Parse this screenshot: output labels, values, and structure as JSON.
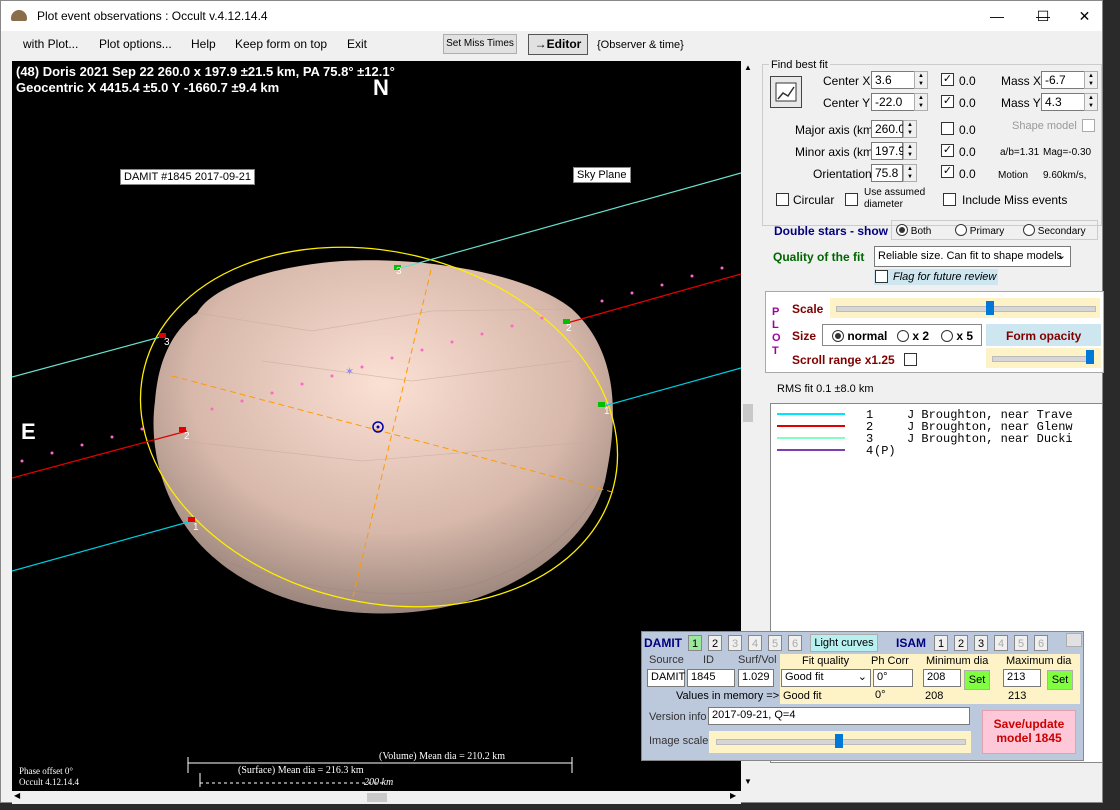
{
  "window": {
    "title": "Plot event observations : Occult v.4.12.14.4",
    "minimize": "—",
    "maximize": "☐",
    "close": "✕"
  },
  "menu": {
    "items": [
      "with Plot...",
      "Plot options...",
      "Help",
      "Keep form on top",
      "Exit"
    ],
    "set_miss_times": "Set Miss Times",
    "editor": "→Editor",
    "observer_time": "{Observer & time}"
  },
  "plot": {
    "header1": "(48) Doris  2021 Sep 22  260.0 x 197.9 ±21.5 km, PA 75.8° ±12.1°",
    "header2": "Geocentric  X  4415.4 ±5.0  Y -1660.7 ±9.4 km",
    "north": "N",
    "east": "E",
    "damit_tag": "DAMIT #1845 2017-09-21",
    "sky_plane": "Sky Plane",
    "phase_offset": "Phase offset 0°",
    "version": "Occult 4.12.14.4",
    "volume_dia": "(Volume) Mean dia = 210.2 km",
    "surface_dia": "(Surface) Mean dia = 216.3 km",
    "scale_bar": "200 km",
    "chord_labels": [
      "1",
      "2",
      "3",
      "1",
      "2",
      "3"
    ]
  },
  "fit": {
    "section_title": "Find best fit",
    "center_x_label": "Center X",
    "center_x": "3.6",
    "center_y_label": "Center Y",
    "center_y": "-22.0",
    "major_label": "Major axis (km)",
    "major": "260.0",
    "minor_label": "Minor axis (km)",
    "minor": "197.9",
    "orient_label": "Orientation",
    "orient": "75.8",
    "zero": "0.0",
    "mass_x_label": "Mass X",
    "mass_x": "-6.7",
    "mass_y_label": "Mass Y",
    "mass_y": "4.3",
    "shape_model_label": "Shape model",
    "ab_ratio": "a/b=1.31",
    "mag": "Mag=-0.30",
    "motion_label": "Motion",
    "motion": "9.60km/s,",
    "circular": "Circular",
    "use_assumed": "Use assumed diameter",
    "include_miss": "Include Miss events",
    "double_stars_label": "Double stars - show",
    "ds_both": "Both",
    "ds_primary": "Primary",
    "ds_secondary": "Secondary",
    "quality_label": "Quality of the fit",
    "quality_value": "Reliable size. Can fit to shape models",
    "flag_review": "Flag for future review"
  },
  "plotbox": {
    "vertical": [
      "P",
      "L",
      "O",
      "T"
    ],
    "scale_label": "Scale",
    "scale_level": 0.6,
    "size_label": "Size",
    "size_normal": "normal",
    "size_x2": "x 2",
    "size_x5": "x 5",
    "form_opacity": "Form opacity",
    "scroll_range": "Scroll range x1.25"
  },
  "rms": "RMS fit 0.1 ±8.0 km",
  "legend": {
    "rows": [
      {
        "color": "#00e5ff",
        "num": "1",
        "text": "J Broughton, near Trave"
      },
      {
        "color": "#e00000",
        "num": "2",
        "text": "J Broughton, near Glenw"
      },
      {
        "color": "#80ffc0",
        "num": "3",
        "text": "J Broughton, near Ducki"
      },
      {
        "color": "#7a3fb0",
        "num": "4",
        "text": "(P)"
      }
    ]
  },
  "damit": {
    "title": "DAMIT",
    "nums": [
      "1",
      "2",
      "3",
      "4",
      "5",
      "6"
    ],
    "light_curves": "Light curves",
    "isam": "ISAM",
    "isam_nums": [
      "1",
      "2",
      "3",
      "4",
      "5",
      "6"
    ],
    "source_label": "Source",
    "id_label": "ID",
    "surf_vol_label": "Surf/Vol",
    "source": "DAMIT",
    "id": "1845",
    "surf_vol": "1.029",
    "fit_quality_label": "Fit quality",
    "ph_corr_label": "Ph Corr",
    "min_dia_label": "Minimum dia",
    "max_dia_label": "Maximum dia",
    "fit_quality": "Good fit",
    "ph_corr": "0°",
    "min_dia": "208",
    "max_dia": "213",
    "set": "Set",
    "values_mem_label": "Values in memory =>",
    "mem_fit": "Good fit",
    "mem_ph": "0°",
    "mem_min": "208",
    "mem_max": "213",
    "version_label": "Version info",
    "version": "2017-09-21, Q=4",
    "image_scale_label": "Image scale",
    "save_button": "Save/update model 1845"
  }
}
